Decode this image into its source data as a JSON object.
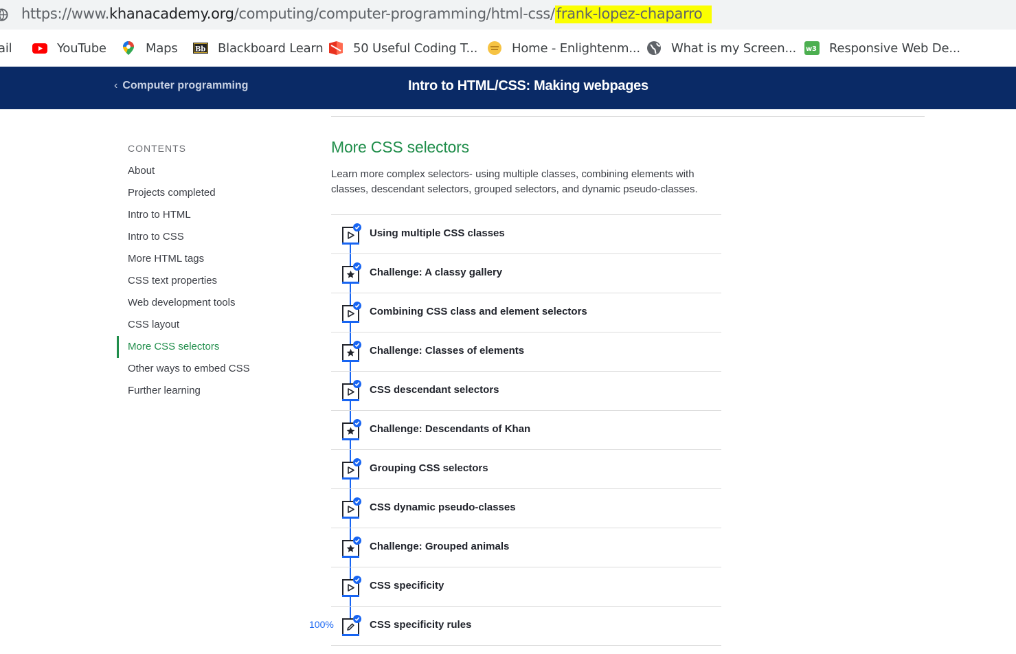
{
  "browser": {
    "url_prefix": "https://www.",
    "url_domain": "khanacademy.org",
    "url_path": "/computing/computer-programming/html-css/",
    "url_highlighted": "frank-lopez-chaparro"
  },
  "bookmarks": [
    {
      "label": "ail",
      "icon": "gmail-icon"
    },
    {
      "label": "YouTube",
      "icon": "youtube-icon"
    },
    {
      "label": "Maps",
      "icon": "maps-pin-icon"
    },
    {
      "label": "Blackboard Learn",
      "icon": "blackboard-icon"
    },
    {
      "label": "50 Useful Coding T...",
      "icon": "coding-site-icon"
    },
    {
      "label": "Home - Enlightenm...",
      "icon": "enlightenment-icon"
    },
    {
      "label": "What is my Screen...",
      "icon": "globe-icon"
    },
    {
      "label": "Responsive Web De...",
      "icon": "w3schools-icon"
    }
  ],
  "header": {
    "back_label": "Computer programming",
    "title": "Intro to HTML/CSS: Making webpages",
    "bg_color": "#0a2a66"
  },
  "sidebar": {
    "heading": "CONTENTS",
    "items": [
      {
        "label": "About"
      },
      {
        "label": "Projects completed"
      },
      {
        "label": "Intro to HTML"
      },
      {
        "label": "Intro to CSS"
      },
      {
        "label": "More HTML tags"
      },
      {
        "label": "CSS text properties"
      },
      {
        "label": "Web development tools"
      },
      {
        "label": "CSS layout"
      },
      {
        "label": "More CSS selectors",
        "active": true
      },
      {
        "label": "Other ways to embed CSS"
      },
      {
        "label": "Further learning"
      }
    ]
  },
  "main": {
    "section_title": "More CSS selectors",
    "description": "Learn more complex selectors- using multiple classes, combining elements with classes, descendant selectors, grouped selectors, and dynamic pseudo-classes.",
    "progress_label": "100%",
    "lessons": [
      {
        "label": "Using multiple CSS classes",
        "type": "video",
        "completed": true
      },
      {
        "label": "Challenge: A classy gallery",
        "type": "challenge",
        "completed": true
      },
      {
        "label": "Combining CSS class and element selectors",
        "type": "video",
        "completed": true
      },
      {
        "label": "Challenge: Classes of elements",
        "type": "challenge",
        "completed": true
      },
      {
        "label": "CSS descendant selectors",
        "type": "video",
        "completed": true
      },
      {
        "label": "Challenge: Descendants of Khan",
        "type": "challenge",
        "completed": true
      },
      {
        "label": "Grouping CSS selectors",
        "type": "video",
        "completed": true
      },
      {
        "label": "CSS dynamic pseudo-classes",
        "type": "video",
        "completed": true
      },
      {
        "label": "Challenge: Grouped animals",
        "type": "challenge",
        "completed": true
      },
      {
        "label": "CSS specificity",
        "type": "video",
        "completed": true
      },
      {
        "label": "CSS specificity rules",
        "type": "article",
        "completed": true
      }
    ]
  },
  "colors": {
    "accent_green": "#1f8d4a",
    "progress_blue": "#1865f2",
    "url_highlight": "#fbff00"
  }
}
